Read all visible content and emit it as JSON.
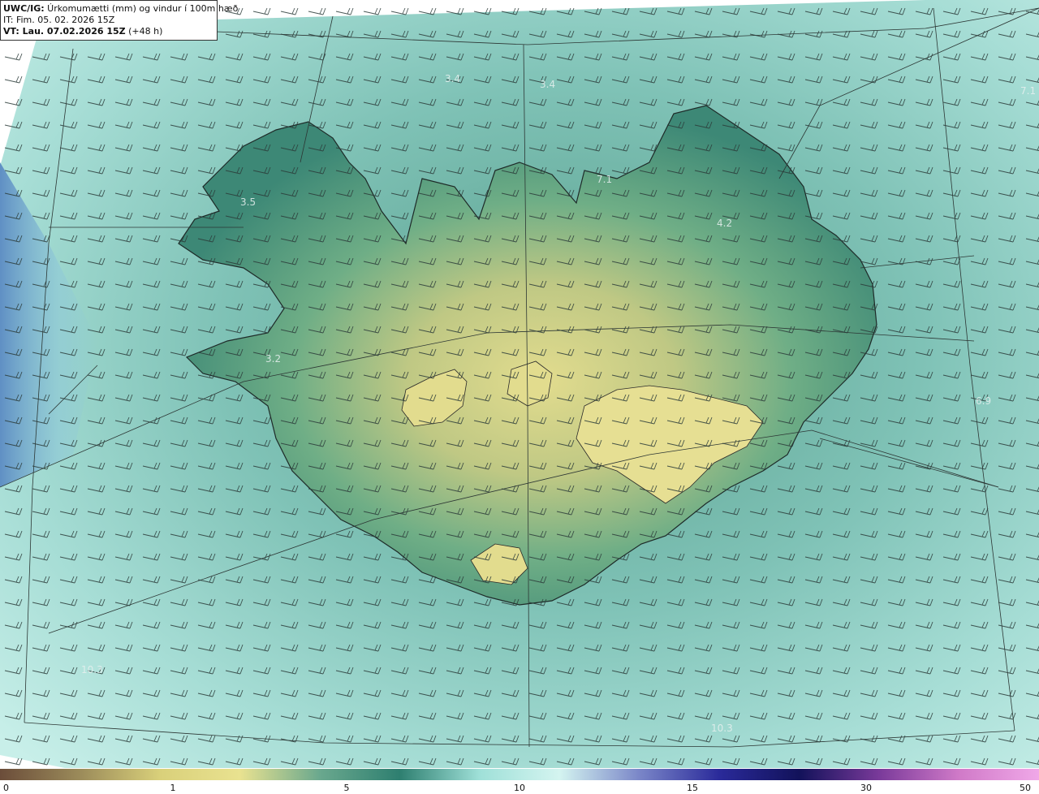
{
  "header": {
    "model_label": "UWC/IG:",
    "title": " Úrkomumætti (mm) og vindur í 100m hæð",
    "it_line": "IT: Fim. 05. 02. 2026 15Z",
    "vt_label": "VT: Lau. 07.02.2026 15Z",
    "vt_lead": " (+48 h)"
  },
  "map_labels": [
    "3.4",
    "3.5",
    "3.2",
    "4.2",
    "7.1",
    "6.9",
    "3.4",
    "7.1",
    "10.3",
    "10.3"
  ],
  "colorbar": {
    "ticks": [
      "0",
      "1",
      "5",
      "10",
      "15",
      "30",
      "50"
    ],
    "colors": [
      "#6b4d3a",
      "#9b8b5a",
      "#d9d07a",
      "#e9e290",
      "#6aa88e",
      "#2e7f70",
      "#9fe0d8",
      "#d4f4f0",
      "#7a86c8",
      "#2a2a9a",
      "#12125a",
      "#7a3a9a",
      "#d07ac8",
      "#f0a8e8"
    ]
  },
  "colors": {
    "sea": "#7fc7bf",
    "sea_light": "#a9e1d9",
    "sea_blue": "#6ea0cc",
    "land_low": "#3f8f7a",
    "land_mid": "#7fb88a",
    "land_high": "#d9d587"
  }
}
